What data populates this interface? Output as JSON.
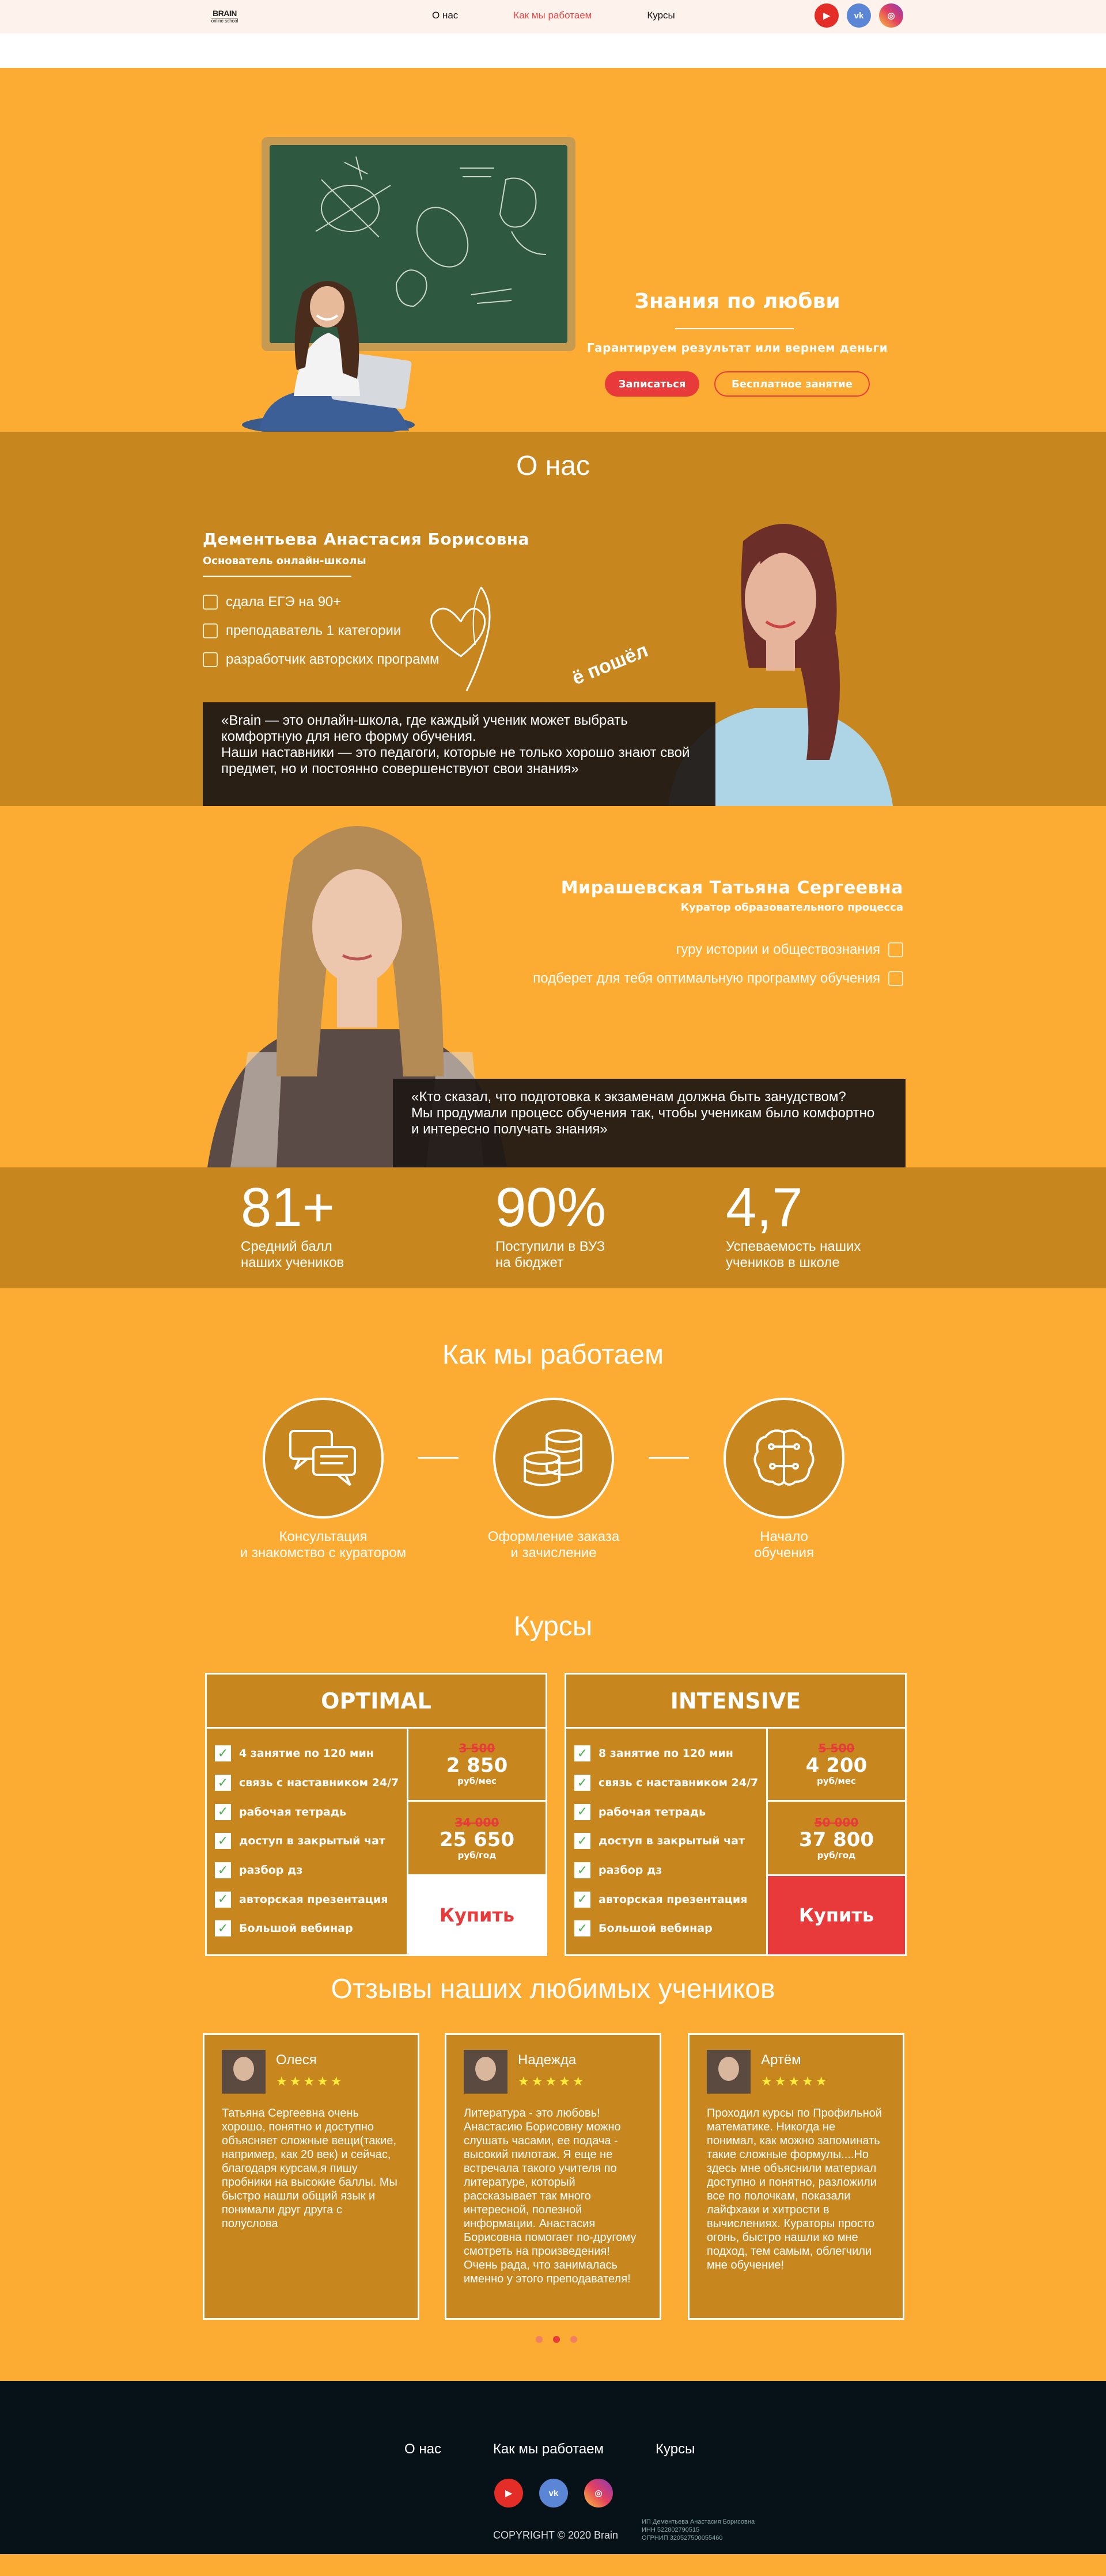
{
  "header": {
    "logo_text": "BRAIN",
    "logo_sub": "online school",
    "nav": [
      "О нас",
      "Как мы работаем",
      "Курсы"
    ],
    "active_nav": "Как мы работаем",
    "social": [
      "youtube-icon",
      "vk-icon",
      "instagram-icon"
    ]
  },
  "hero": {
    "title": "Знания по любви",
    "subtitle": "Гарантируем результат или вернем деньги",
    "signup_button": "Записаться",
    "free_lesson_button": "Бесплатное занятие"
  },
  "about": {
    "title": "О нас",
    "person_name": "Дементьева Анастасия Борисовна",
    "person_role": "Основатель онлайн-школы",
    "features": [
      "сдала ЕГЭ на 90+",
      "преподаватель 1 категории",
      "разработчик авторских программ"
    ],
    "sticker": "ё пошёл",
    "quote_lines": [
      "«Brain — это онлайн-школа, где каждый ученик может выбрать",
      "комфортную для него форму обучения.",
      "Наши наставники — это педагоги, которые не только хорошо знают свой",
      "предмет, но и постоянно совершенствуют свои знания»"
    ]
  },
  "curator": {
    "person_name": "Мирашевская Татьяна Сергеевна",
    "person_role": "Куратор образовательного процесса",
    "features": [
      "гуру истории и обществознания",
      "подберет для тебя оптимальную программу обучения"
    ],
    "quote_lines": [
      "«Кто сказал, что подготовка к экзаменам должна быть занудством?",
      "Мы продумали процесс обучения так, чтобы ученикам было комфортно",
      "и интересно получать знания»"
    ]
  },
  "stats": [
    {
      "value": "81+",
      "label_1": "Средний балл",
      "label_2": "наших учеников"
    },
    {
      "value": "90%",
      "label_1": "Поступили в ВУЗ",
      "label_2": "на бюджет"
    },
    {
      "value": "4,7",
      "label_1": "Успеваемость наших",
      "label_2": "учеников в школе"
    }
  ],
  "how": {
    "title": "Как мы работаем",
    "steps": [
      {
        "icon": "chat-icon",
        "line_1": "Консультация",
        "line_2": "и знакомство с куратором"
      },
      {
        "icon": "coins-icon",
        "line_1": "Оформление заказа",
        "line_2": "и зачисление"
      },
      {
        "icon": "brain-icon",
        "line_1": "Начало",
        "line_2": "обучения"
      }
    ]
  },
  "courses": {
    "title": "Курсы",
    "cards": [
      {
        "name": "OPTIMAL",
        "features": [
          "4 занятие по 120 мин",
          "связь с наставником 24/7",
          "рабочая тетрадь",
          "доступ в закрытый чат",
          "разбор дз",
          "авторская презентация",
          "Большой вебинар"
        ],
        "month_old": "3 500",
        "month_new": "2 850",
        "month_unit": "руб/мес",
        "year_old": "34 000",
        "year_new": "25 650",
        "year_unit": "руб/год",
        "buy": "Купить"
      },
      {
        "name": "INTENSIVE",
        "features": [
          "8 занятие по 120 мин",
          "связь с наставником 24/7",
          "рабочая тетрадь",
          "доступ в закрытый чат",
          "разбор дз",
          "авторская презентация",
          "Большой вебинар"
        ],
        "month_old": "5 500",
        "month_new": "4 200",
        "month_unit": "руб/мес",
        "year_old": "50 000",
        "year_new": "37 800",
        "year_unit": "руб/год",
        "buy": "Купить"
      }
    ]
  },
  "reviews": {
    "title": "Отзывы наших любимых учеников",
    "stars": "★★★★★",
    "items": [
      {
        "name": "Олеся",
        "text": "Татьяна Сергеевна очень хорошо, понятно и доступно объясняет сложные вещи(такие, например, как 20 век) и сейчас, благодаря курсам,я пишу пробники на высокие баллы. Мы быстро нашли общий язык и понимали друг друга с полуслова"
      },
      {
        "name": "Надежда",
        "text": "Литература - это любовь! Анастасию Борисовну можно слушать часами, ее подача - высокий пилотаж. Я еще не встречала такого учителя по литературе, который рассказывает так много интересной, полезной информации. Анастасия Борисовна помогает по-другому смотреть на произведения! Очень рада, что занималась именно у этого преподавателя!"
      },
      {
        "name": "Артём",
        "text": "Проходил курсы по Профильной математике. Никогда не понимал, как можно запоминать такие сложные формулы....Но здесь мне объяснили материал доступно и понятно, разложили все по полочкам, показали лайфхаки и хитрости в вычислениях. Кураторы просто огонь, быстро нашли ко мне подход, тем самым, облегчили мне обучение!"
      }
    ],
    "active_dot": 1
  },
  "footer": {
    "nav": [
      "О нас",
      "Как мы работаем",
      "Курсы"
    ],
    "copyright": "COPYRIGHT © 2020 Brain",
    "legal_1": "ИП Дементьева Анастасия Борисовна",
    "legal_2": "ИНН 522802790515",
    "legal_3": "ОГРНИП 320527500055460"
  },
  "colors": {
    "orange": "#fcac32",
    "dark_orange": "#c8861e",
    "red": "#e83a3a",
    "footer": "#071118"
  }
}
